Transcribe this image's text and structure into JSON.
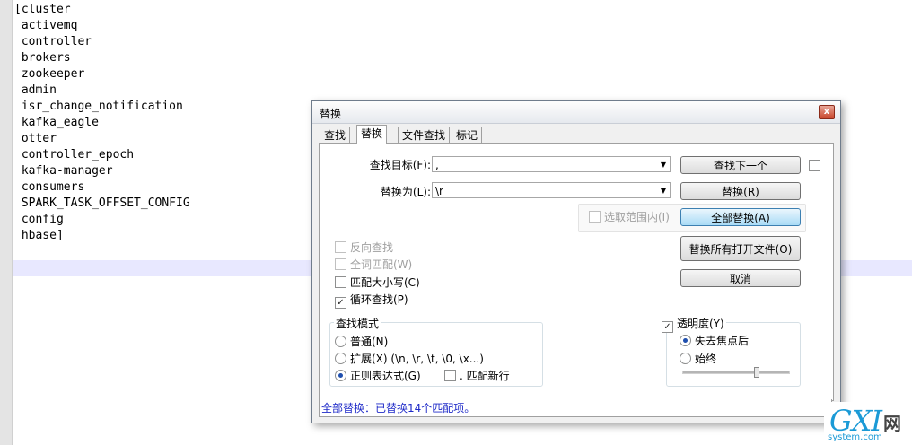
{
  "editor": {
    "lines": [
      "[cluster",
      " activemq",
      " controller",
      " brokers",
      " zookeeper",
      " admin",
      " isr_change_notification",
      " kafka_eagle",
      " otter",
      " controller_epoch",
      " kafka-manager",
      " consumers",
      " SPARK_TASK_OFFSET_CONFIG",
      " config",
      " hbase]"
    ]
  },
  "dialog": {
    "title": "替换",
    "close": "x",
    "tabs": [
      "查找",
      "替换",
      "文件查找",
      "标记"
    ],
    "find_label": "查找目标(F):",
    "find_value": ",",
    "replace_label": "替换为(L):",
    "replace_value": "\\r",
    "dropdown_arrow": "▼",
    "buttons": {
      "find_next": "查找下一个",
      "replace": "替换(R)",
      "replace_all": "全部替换(A)",
      "replace_all_open": "替换所有打开文件(O)",
      "cancel": "取消"
    },
    "in_selection": "选取范围内(I)",
    "options": {
      "backward": "反向查找",
      "whole_word": "全词匹配(W)",
      "match_case": "匹配大小写(C)",
      "wrap": "循环查找(P)"
    },
    "search_mode": {
      "legend": "查找模式",
      "normal": "普通(N)",
      "extended": "扩展(X) (\\n, \\r, \\t, \\0, \\x...)",
      "regex": "正则表达式(G)",
      "dot_newline": ". 匹配新行"
    },
    "transparency": {
      "legend": "透明度(Y)",
      "on_lose_focus": "失去焦点后",
      "always": "始终",
      "level": 0.7
    },
    "status": "全部替换：已替换14个匹配项。",
    "checkmark": "✓"
  },
  "watermark": {
    "logo": "GXI",
    "wang": "网",
    "site": "system.com"
  }
}
